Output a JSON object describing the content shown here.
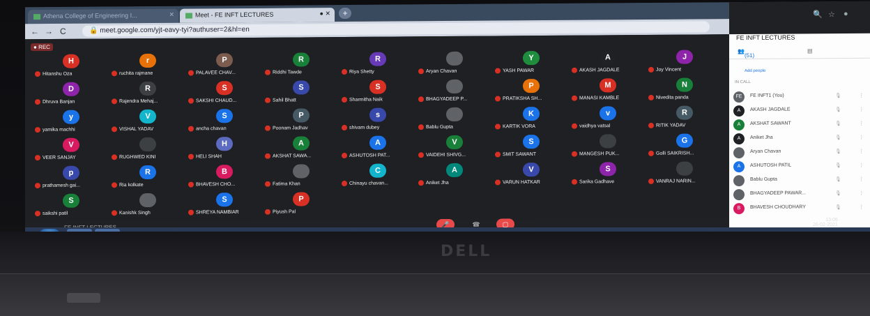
{
  "browser": {
    "tab1_title": "Athena College of Engineering I...",
    "tab2_title": "Meet - FE INFT LECTURES",
    "url": "meet.google.com/yjt-eavy-tyi?authuser=2&hl=en"
  },
  "meeting": {
    "rec_label": "REC",
    "title": "FE INFT LECTURES",
    "participants": [
      {
        "initial": "H",
        "name": "Hitanshu Oza",
        "color": "#d93025"
      },
      {
        "initial": "r",
        "name": "ruchita rajmane",
        "color": "#e8710a"
      },
      {
        "initial": "P",
        "name": "PALAVEE CHAV...",
        "color": "#7b5c4e"
      },
      {
        "initial": "R",
        "name": "Riddhi Tawde",
        "color": "#188038"
      },
      {
        "initial": "R",
        "name": "Riya Shetty",
        "color": "#673ab7"
      },
      {
        "initial": "",
        "name": "Aryan Chavan",
        "color": "#5f6368"
      },
      {
        "initial": "Y",
        "name": "YASH PAWAR",
        "color": "#1e8e3e"
      },
      {
        "initial": "A",
        "name": "AKASH JAGDALE",
        "color": "#202124"
      },
      {
        "initial": "J",
        "name": "Joy Vincent",
        "color": "#8e24aa"
      },
      {
        "initial": "D",
        "name": "Dhruva Banjan",
        "color": "#8e24aa"
      },
      {
        "initial": "R",
        "name": "Rajendra Mehaj...",
        "color": "#3c4043"
      },
      {
        "initial": "S",
        "name": "SAKSHI CHAUD...",
        "color": "#d93025"
      },
      {
        "initial": "S",
        "name": "Sahil Bhatt",
        "color": "#3949ab"
      },
      {
        "initial": "S",
        "name": "Sharmitha Naik",
        "color": "#d93025"
      },
      {
        "initial": "",
        "name": "BHAGYADEEP P...",
        "color": "#5f6368"
      },
      {
        "initial": "P",
        "name": "PRATIKSHA SH...",
        "color": "#e8710a"
      },
      {
        "initial": "M",
        "name": "MANASI KAMBLE",
        "color": "#d93025"
      },
      {
        "initial": "N",
        "name": "Nivedita panda",
        "color": "#188038"
      },
      {
        "initial": "y",
        "name": "yamika machhi",
        "color": "#1a73e8"
      },
      {
        "initial": "V",
        "name": "VISHAL YADAV",
        "color": "#12b5cb"
      },
      {
        "initial": "S",
        "name": "ancha chavan",
        "color": "#1a73e8"
      },
      {
        "initial": "P",
        "name": "Poonam Jadhav",
        "color": "#455a64"
      },
      {
        "initial": "s",
        "name": "shivam dubey",
        "color": "#3949ab"
      },
      {
        "initial": "",
        "name": "Bablu Gupta",
        "color": "#5f6368"
      },
      {
        "initial": "K",
        "name": "KARTIK VORA",
        "color": "#1a73e8"
      },
      {
        "initial": "v",
        "name": "vaidhya vatsal",
        "color": "#1a73e8"
      },
      {
        "initial": "R",
        "name": "RITIK YADAV",
        "color": "#455a64"
      },
      {
        "initial": "V",
        "name": "VEER SANJAY",
        "color": "#d81b60"
      },
      {
        "initial": "",
        "name": "RUGHWED KINI",
        "color": "#3c4043"
      },
      {
        "initial": "H",
        "name": "HELI SHAH",
        "color": "#5c6bc0"
      },
      {
        "initial": "A",
        "name": "AKSHAT SAWA...",
        "color": "#188038"
      },
      {
        "initial": "A",
        "name": "ASHUTOSH PAT...",
        "color": "#1a73e8"
      },
      {
        "initial": "V",
        "name": "VAIDEHI SHIVG...",
        "color": "#188038"
      },
      {
        "initial": "S",
        "name": "SMIT SAWANT",
        "color": "#1a73e8"
      },
      {
        "initial": "",
        "name": "MANGESH PUK...",
        "color": "#3c4043"
      },
      {
        "initial": "G",
        "name": "Golli SAIKRISH...",
        "color": "#1a73e8"
      },
      {
        "initial": "p",
        "name": "prathamesh gai...",
        "color": "#3949ab"
      },
      {
        "initial": "R",
        "name": "Ria kolkate",
        "color": "#1a73e8"
      },
      {
        "initial": "B",
        "name": "BHAVESH CHO...",
        "color": "#d81b60"
      },
      {
        "initial": "",
        "name": "Fatima Khan",
        "color": "#5f6368"
      },
      {
        "initial": "C",
        "name": "Chinayu chavan...",
        "color": "#12b5cb"
      },
      {
        "initial": "A",
        "name": "Aniket Jha",
        "color": "#00897b"
      },
      {
        "initial": "V",
        "name": "VARUN HATKAR",
        "color": "#3949ab"
      },
      {
        "initial": "S",
        "name": "Sarika Gadhave",
        "color": "#8e24aa"
      },
      {
        "initial": "",
        "name": "VANRAJ NARIN...",
        "color": "#3c4043"
      },
      {
        "initial": "S",
        "name": "saikshi patil",
        "color": "#188038"
      },
      {
        "initial": "",
        "name": "Kanishk Singh",
        "color": "#5f6368"
      },
      {
        "initial": "S",
        "name": "SHREYA NAMBIAR",
        "color": "#1a73e8"
      },
      {
        "initial": "P",
        "name": "Piyush Pal",
        "color": "#d93025"
      }
    ]
  },
  "panel": {
    "title": "FE INFT LECTURES",
    "count": "(51)",
    "add_people": "Add people",
    "in_call": "IN CALL",
    "people": [
      {
        "initial": "FE",
        "name": "FE INFT1 (You)",
        "color": "#5f6368"
      },
      {
        "initial": "A",
        "name": "AKASH JAGDALE",
        "color": "#202124"
      },
      {
        "initial": "A",
        "name": "AKSHAT SAWANT",
        "color": "#188038"
      },
      {
        "initial": "A",
        "name": "Aniket Jha",
        "color": "#202124"
      },
      {
        "initial": "",
        "name": "Aryan Chavan",
        "color": "#5f6368"
      },
      {
        "initial": "A",
        "name": "ASHUTOSH PATIL",
        "color": "#1a73e8"
      },
      {
        "initial": "",
        "name": "Bablu Gupta",
        "color": "#5f6368"
      },
      {
        "initial": "",
        "name": "BHAGYADEEP PAWAR...",
        "color": "#5f6368"
      },
      {
        "initial": "B",
        "name": "BHAVESH CHOUDHARY",
        "color": "#d81b60"
      }
    ]
  },
  "taskbar": {
    "time": "13:06",
    "date": "26-02-2021"
  },
  "laptop": {
    "brand": "DELL"
  }
}
